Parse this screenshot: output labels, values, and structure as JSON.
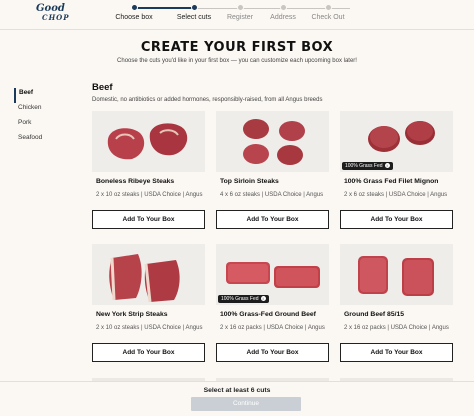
{
  "brand": {
    "line1": "Good",
    "line2": "CHOP"
  },
  "steps": [
    {
      "label": "Choose box",
      "state": "done"
    },
    {
      "label": "Select cuts",
      "state": "active"
    },
    {
      "label": "Register",
      "state": "pending"
    },
    {
      "label": "Address",
      "state": "pending"
    },
    {
      "label": "Check Out",
      "state": "pending"
    }
  ],
  "page": {
    "title": "CREATE YOUR FIRST BOX",
    "subtitle": "Choose the cuts you'd like in your first box — you can customize each upcoming box later!"
  },
  "sidebar": {
    "items": [
      {
        "label": "Beef",
        "active": true
      },
      {
        "label": "Chicken",
        "active": false
      },
      {
        "label": "Pork",
        "active": false
      },
      {
        "label": "Seafood",
        "active": false
      }
    ]
  },
  "section": {
    "title": "Beef",
    "description": "Domestic, no antibiotics or added hormones, responsibly-raised, from all Angus breeds"
  },
  "products": [
    {
      "name": "Boneless Ribeye Steaks",
      "desc": "2 x 10 oz steaks | USDA Choice | Angus",
      "button": "Add To Your Box",
      "badge": ""
    },
    {
      "name": "Top Sirloin Steaks",
      "desc": "4 x 6 oz steaks | USDA Choice | Angus",
      "button": "Add To Your Box",
      "badge": ""
    },
    {
      "name": "100% Grass Fed Filet Mignon",
      "desc": "2 x 6 oz steaks | USDA Choice | Angus",
      "button": "Add To Your Box",
      "badge": "100% Grass Fed"
    },
    {
      "name": "New York Strip Steaks",
      "desc": "2 x 10 oz steaks | USDA Choice | Angus",
      "button": "Add To Your Box",
      "badge": ""
    },
    {
      "name": "100% Grass-Fed Ground Beef",
      "desc": "2 x 16 oz packs | USDA Choice | Angus",
      "button": "Add To Your Box",
      "badge": "100% Grass Fed"
    },
    {
      "name": "Ground Beef 85/15",
      "desc": "2 x 16 oz packs | USDA Choice | Angus",
      "button": "Add To Your Box",
      "badge": ""
    }
  ],
  "footer": {
    "message": "Select at least 6 cuts",
    "continue_label": "Continue"
  },
  "colors": {
    "accent": "#1b3b5c",
    "background": "#fbf8f3",
    "continue_disabled": "#c9cfd4"
  }
}
